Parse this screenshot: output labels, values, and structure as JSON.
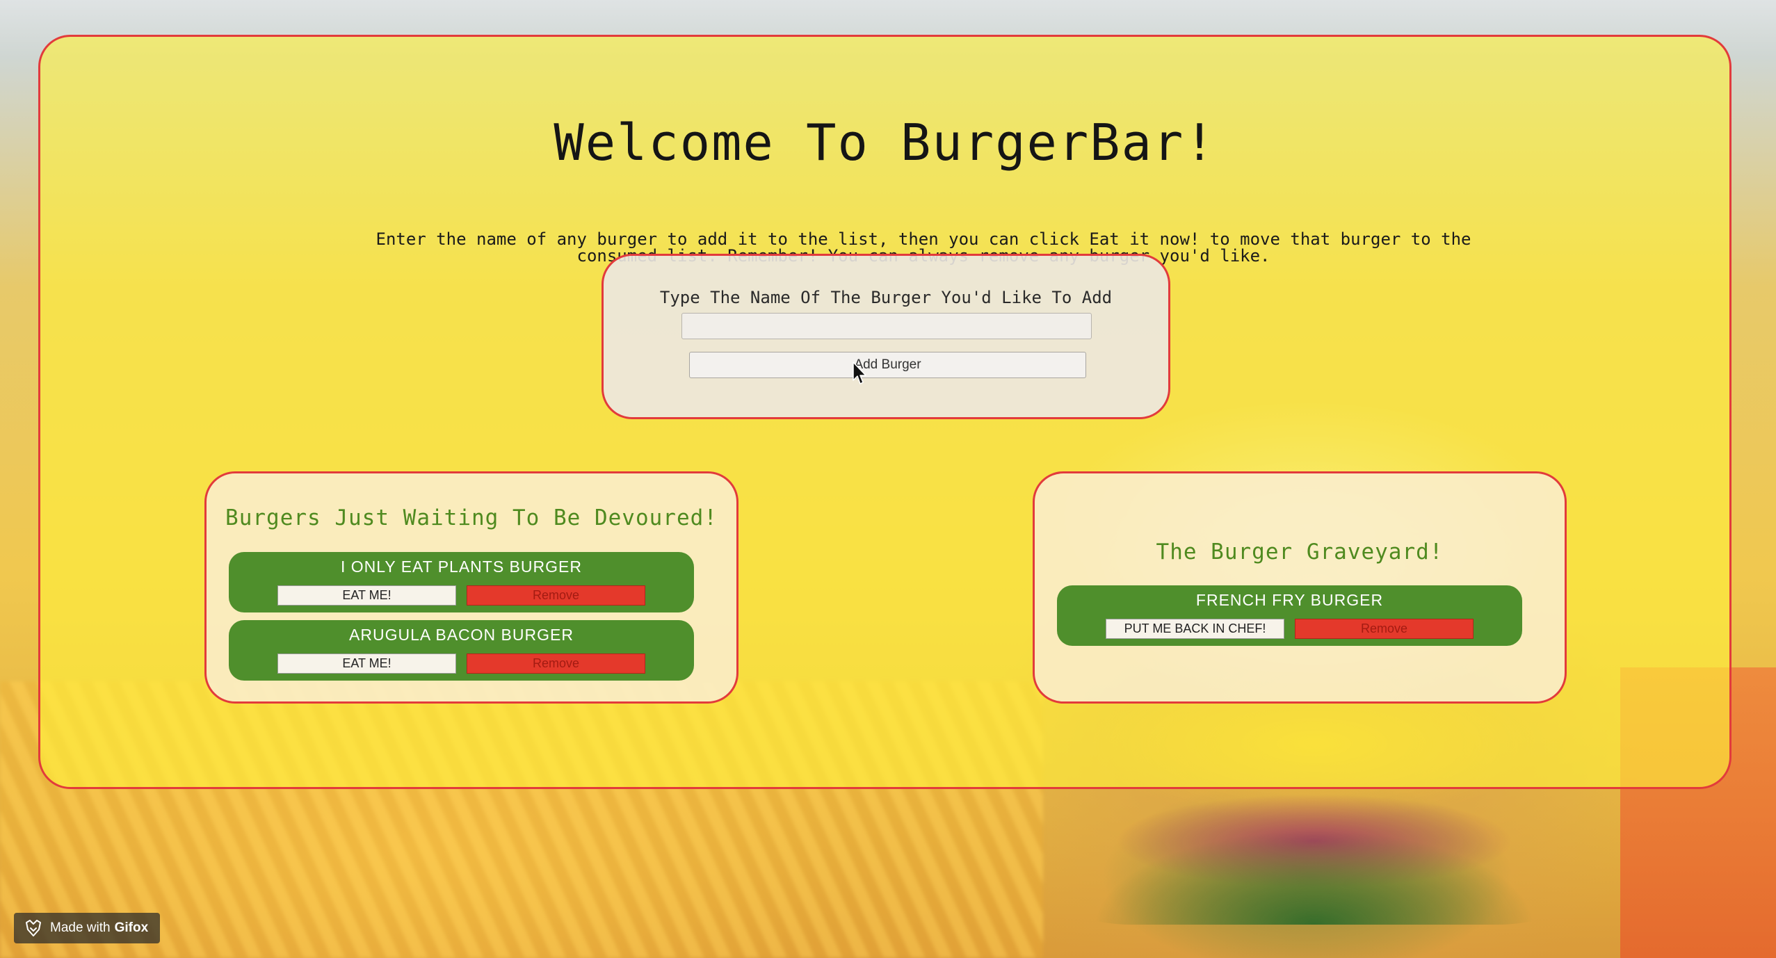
{
  "page": {
    "title": "Welcome To BurgerBar!",
    "intro": "Enter the name of any burger to add it to the list, then you can click Eat it now! to move that burger to the consumed list. Remember! You can always remove any burger you'd like."
  },
  "add_form": {
    "label": "Type The Name Of The Burger You'd Like To Add",
    "input_value": "",
    "button_label": "Add Burger"
  },
  "waiting_list": {
    "title": "Burgers Just Waiting To Be Devoured!",
    "items": [
      {
        "name": "I ONLY EAT PLANTS BURGER",
        "eat_label": "EAT ME!",
        "remove_label": "Remove"
      },
      {
        "name": "ARUGULA BACON BURGER",
        "eat_label": "EAT ME!",
        "remove_label": "Remove"
      }
    ]
  },
  "graveyard_list": {
    "title": "The Burger Graveyard!",
    "items": [
      {
        "name": "FRENCH FRY BURGER",
        "restore_label": "PUT ME BACK IN CHEF!",
        "remove_label": "Remove"
      }
    ]
  },
  "badge": {
    "prefix": "Made with",
    "brand": "Gifox"
  },
  "colors": {
    "panel_border": "#e23b3b",
    "panel_fill": "#fff03c",
    "list_title": "#4f8a1f",
    "item_fill": "#4f8f2c",
    "remove_button": "#e4392b"
  },
  "icons": [
    "mouse-pointer-icon",
    "gifox-logo-icon"
  ]
}
